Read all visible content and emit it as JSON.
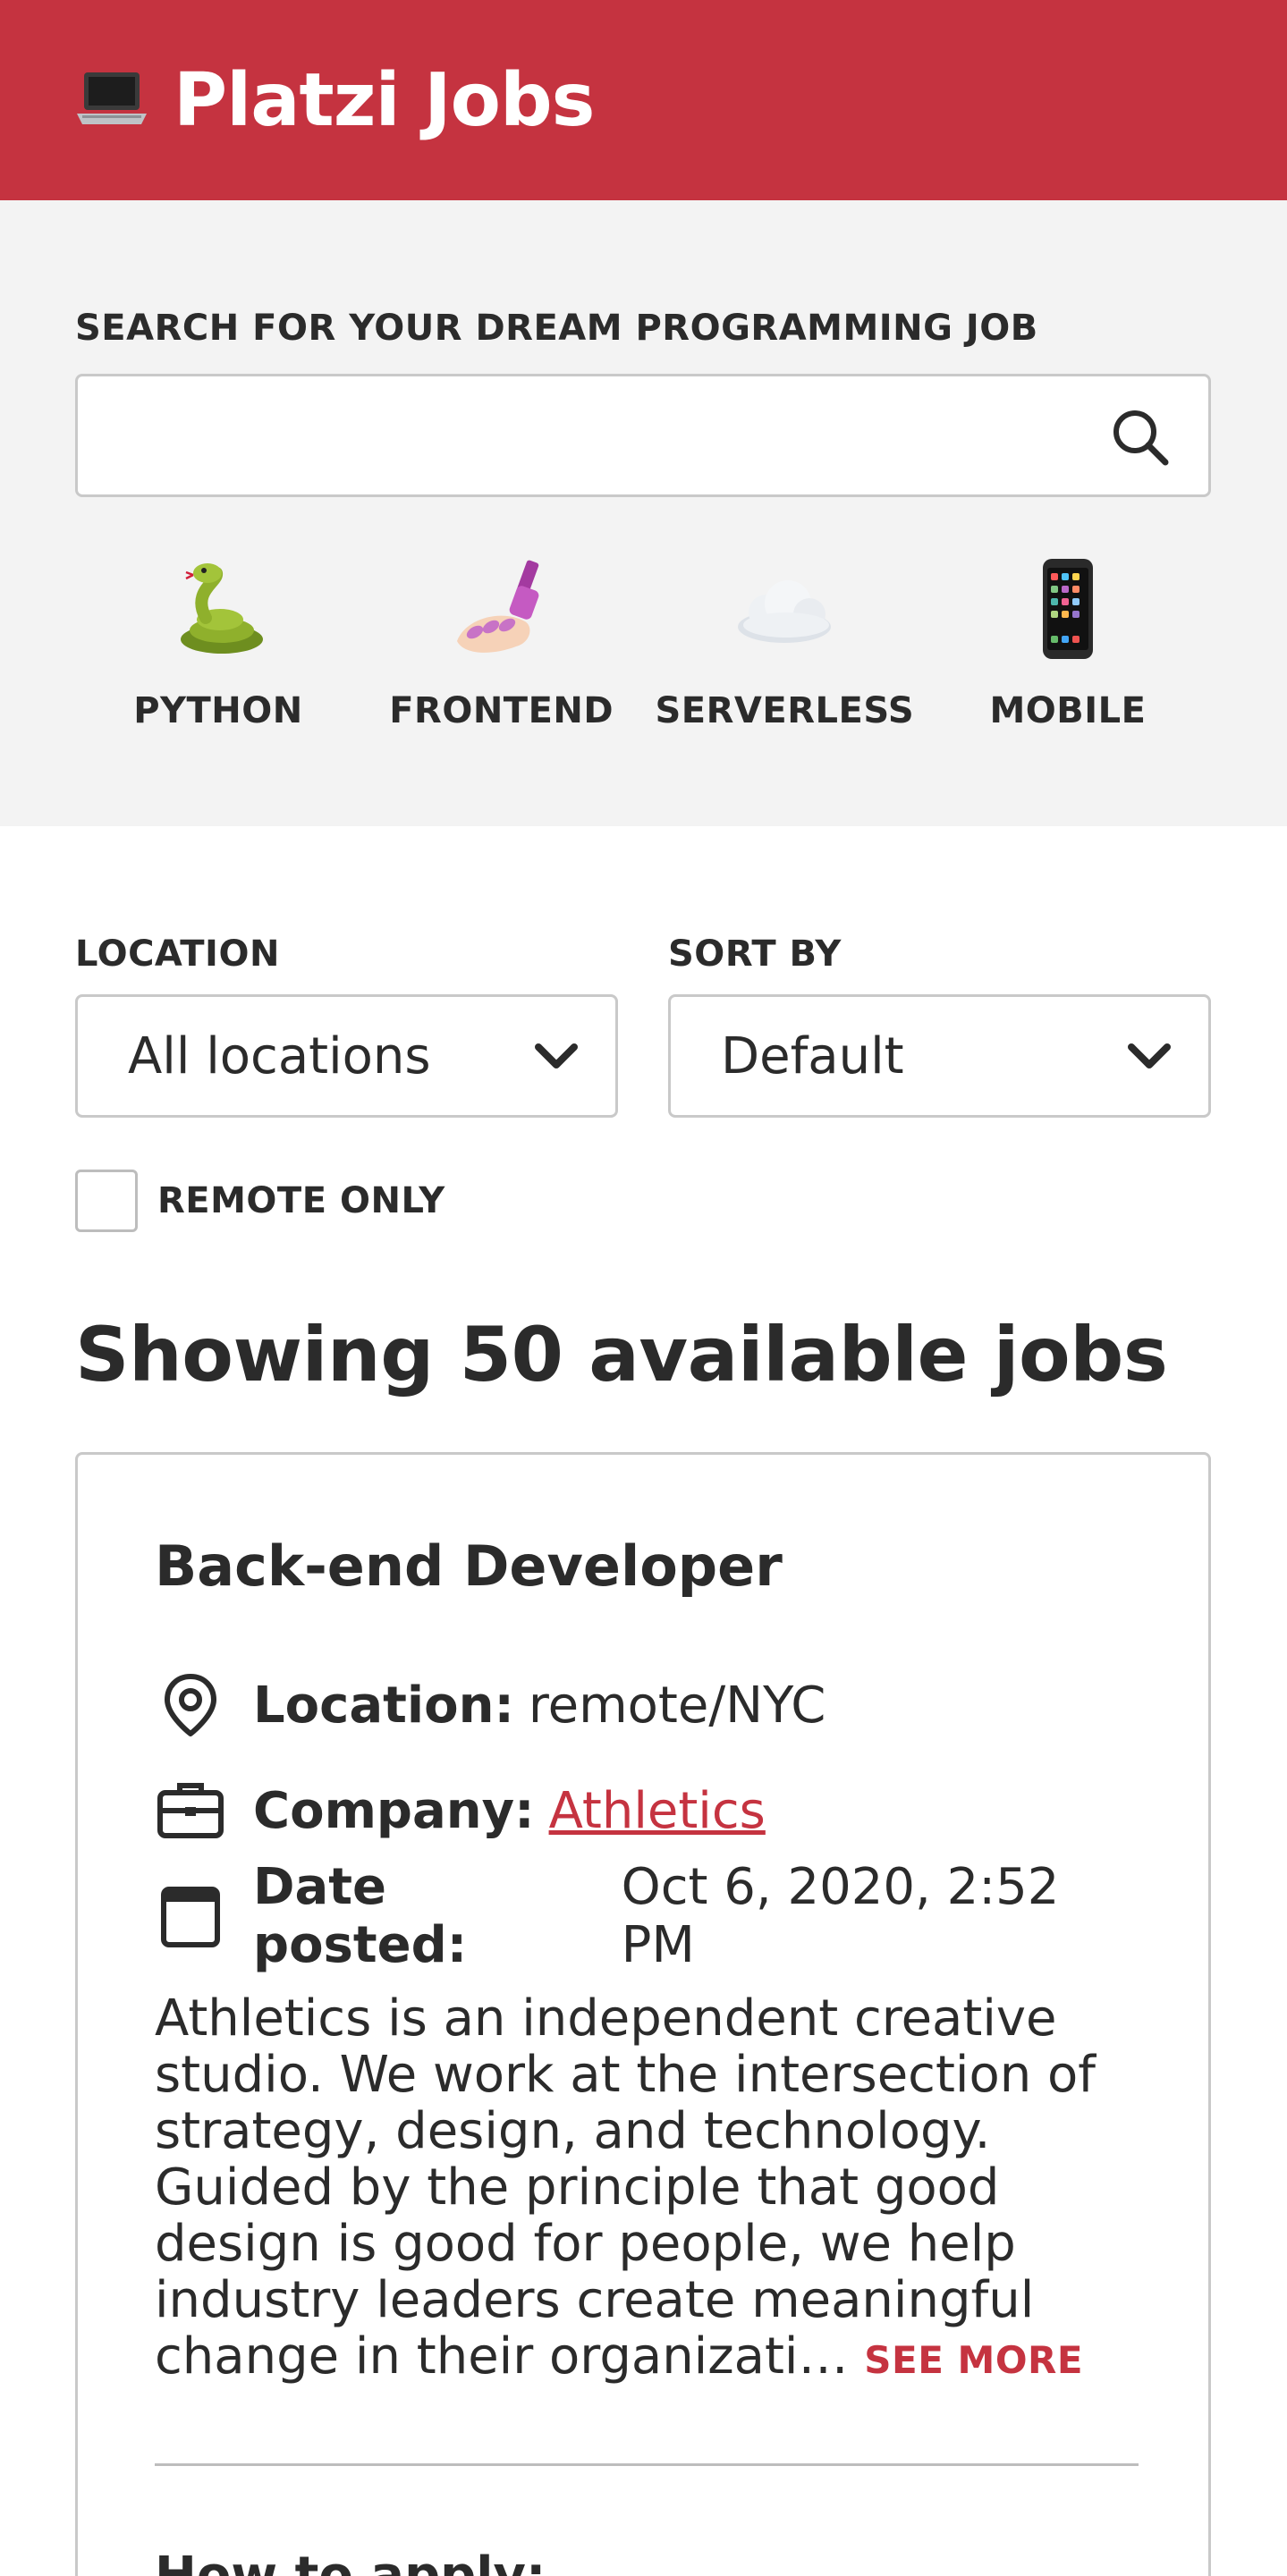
{
  "header": {
    "title": "Platzi Jobs",
    "logo_icon": "laptop-icon",
    "background": "#c53340"
  },
  "search": {
    "label": "SEARCH FOR YOUR DREAM PROGRAMMING JOB",
    "value": "",
    "placeholder": ""
  },
  "categories": [
    {
      "label": "PYTHON",
      "icon": "snake-emoji"
    },
    {
      "label": "FRONTEND",
      "icon": "nail-polish-emoji"
    },
    {
      "label": "SERVERLESS",
      "icon": "cloud-emoji"
    },
    {
      "label": "MOBILE",
      "icon": "mobile-phone-emoji"
    }
  ],
  "filters": {
    "location": {
      "label": "LOCATION",
      "selected": "All locations"
    },
    "sort": {
      "label": "SORT BY",
      "selected": "Default"
    },
    "remote_only": {
      "label": "REMOTE ONLY",
      "checked": false
    }
  },
  "results": {
    "title": "Showing 50 available jobs"
  },
  "jobs": [
    {
      "title": "Back-end Developer",
      "location_key": "Location:",
      "location": "remote/NYC",
      "company_key": "Company:",
      "company": "Athletics",
      "date_key": "Date posted:",
      "date": "Oct 6, 2020, 2:52 PM",
      "description": "Athletics is an independent creative studio. We work at the intersection of strategy, design, and technology. Guided by the principle that good design is good for people, we help industry leaders create meaningful change in their organizati…",
      "see_more": "SEE MORE",
      "apply_heading": "How to apply:"
    }
  ]
}
